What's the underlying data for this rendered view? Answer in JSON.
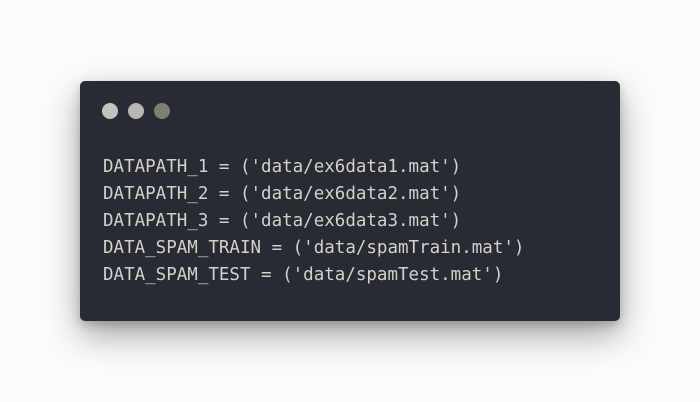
{
  "colors": {
    "window_background": "#282b33",
    "code_text": "#d3d1c9",
    "page_background": "#fbfbfb"
  },
  "window_controls": [
    {
      "icon": "close-dot-icon",
      "color": "#c2c2bf"
    },
    {
      "icon": "minimize-dot-icon",
      "color": "#b9b8b2"
    },
    {
      "icon": "maximize-dot-icon",
      "color": "#7e7f72"
    }
  ],
  "code": {
    "lines": [
      "DATAPATH_1 = ('data/ex6data1.mat')",
      "DATAPATH_2 = ('data/ex6data2.mat')",
      "DATAPATH_3 = ('data/ex6data3.mat')",
      "DATA_SPAM_TRAIN = ('data/spamTrain.mat')",
      "DATA_SPAM_TEST = ('data/spamTest.mat')"
    ]
  }
}
